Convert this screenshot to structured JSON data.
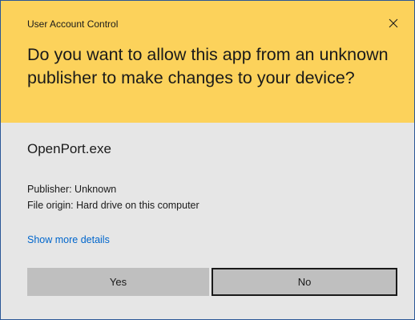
{
  "dialog": {
    "title": "User Account Control",
    "close_icon": "close-icon",
    "question": "Do you want to allow this app from an unknown publisher to make changes to your device?",
    "header_color": "#fcd25b",
    "body_color": "#e6e6e6"
  },
  "app": {
    "name": "OpenPort.exe",
    "publisher": "Publisher: Unknown",
    "file_origin": "File origin: Hard drive on this computer"
  },
  "link": {
    "show_more_details": "Show more details",
    "color": "#0066cc"
  },
  "buttons": {
    "yes_label": "Yes",
    "no_label": "No"
  }
}
